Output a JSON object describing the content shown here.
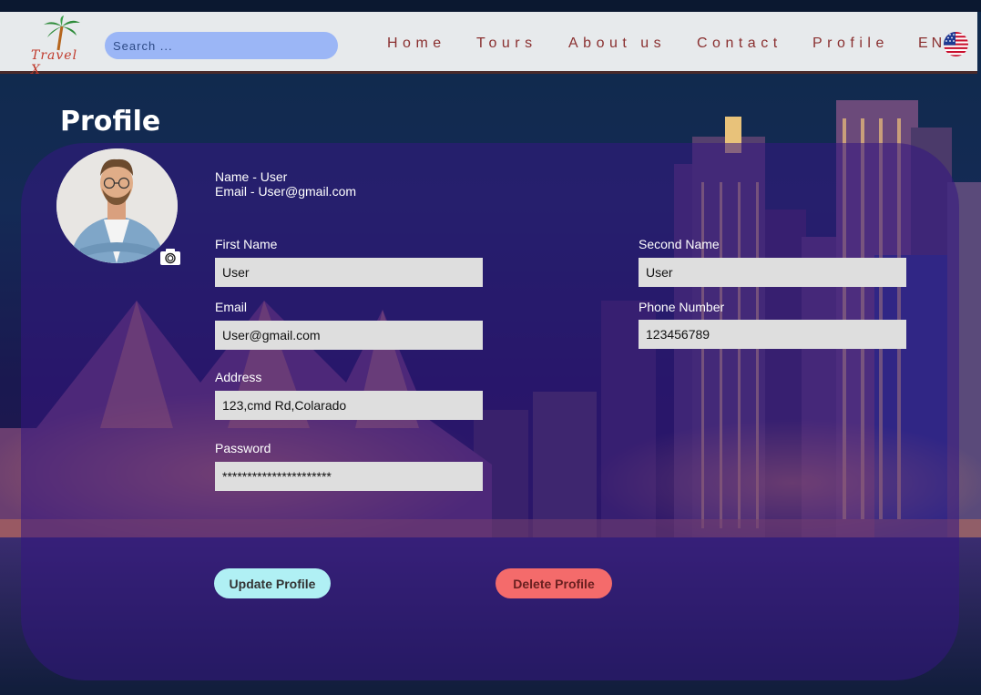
{
  "header": {
    "logo_text": "Travel X",
    "search_placeholder": "Search ...",
    "nav": [
      "Home",
      "Tours",
      "About us",
      "Contact",
      "Profile"
    ],
    "language": "EN"
  },
  "profile": {
    "title": "Profile",
    "name_line": "Name - User",
    "email_line": "Email  - User@gmail.com"
  },
  "form": {
    "first_name": {
      "label": "First Name",
      "value": "User"
    },
    "second_name": {
      "label": "Second Name",
      "value": "User"
    },
    "email": {
      "label": "Email",
      "value": "User@gmail.com"
    },
    "phone": {
      "label": "Phone Number",
      "value": "123456789"
    },
    "address": {
      "label": "Address",
      "value": "123,cmd Rd,Colarado"
    },
    "password": {
      "label": "Password",
      "value": "**********************"
    }
  },
  "buttons": {
    "update": "Update Profile",
    "delete": "Delete Profile"
  },
  "colors": {
    "header_bg": "#e7eaec",
    "nav_text": "#8a3030",
    "search_bg": "#9bb6f6",
    "update_btn": "#b0f0f4",
    "delete_btn": "#f46b6b"
  },
  "icons": [
    "palm-logo-icon",
    "camera-icon",
    "us-flag-icon"
  ]
}
